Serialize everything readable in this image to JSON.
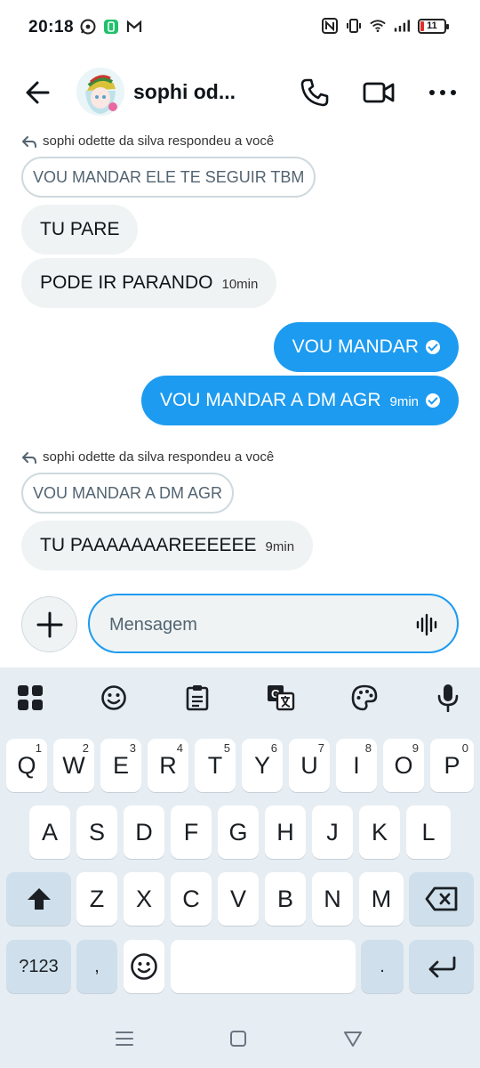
{
  "status_bar": {
    "time": "20:18",
    "battery": "11",
    "notif_icons": [
      "whatsapp-icon",
      "green-app-icon",
      "gmail-icon"
    ],
    "right_icons": [
      "nfc-icon",
      "vibrate-icon",
      "wifi-icon",
      "signal-icon",
      "battery-icon"
    ]
  },
  "header": {
    "name": "sophi od...",
    "icons": [
      "back-arrow-icon",
      "phone-icon",
      "video-icon",
      "more-icon"
    ]
  },
  "messages": {
    "reply_note_1": "sophi odette da silva respondeu a você",
    "quote_1": "VOU MANDAR ELE TE SEGUIR TBM",
    "in_1": "TU PARE",
    "in_2": "PODE IR PARANDO",
    "in_2_time": "10min",
    "out_1": "VOU MANDAR",
    "out_2": "VOU MANDAR A DM AGR",
    "out_2_time": "9min",
    "reply_note_2": "sophi odette da silva respondeu a você",
    "quote_2": "VOU MANDAR A DM AGR",
    "in_3": "TU PAAAAAAAREEEEEE",
    "in_3_time": "9min"
  },
  "composer": {
    "placeholder": "Mensagem",
    "plus_icon": "plus-icon",
    "voice_icon": "waveform-icon"
  },
  "keyboard": {
    "toolbar": [
      "apps-grid-icon",
      "emoji-icon",
      "clipboard-icon",
      "translate-icon",
      "palette-icon",
      "mic-icon"
    ],
    "row1": [
      {
        "k": "Q",
        "n": "1"
      },
      {
        "k": "W",
        "n": "2"
      },
      {
        "k": "E",
        "n": "3"
      },
      {
        "k": "R",
        "n": "4"
      },
      {
        "k": "T",
        "n": "5"
      },
      {
        "k": "Y",
        "n": "6"
      },
      {
        "k": "U",
        "n": "7"
      },
      {
        "k": "I",
        "n": "8"
      },
      {
        "k": "O",
        "n": "9"
      },
      {
        "k": "P",
        "n": "0"
      }
    ],
    "row2": [
      "A",
      "S",
      "D",
      "F",
      "G",
      "H",
      "J",
      "K",
      "L"
    ],
    "row3": [
      "Z",
      "X",
      "C",
      "V",
      "B",
      "N",
      "M"
    ],
    "symbols_key": "?123",
    "comma_key": ",",
    "period_key": "."
  },
  "navbar": [
    "menu-icon",
    "home-square-icon",
    "back-triangle-icon"
  ]
}
